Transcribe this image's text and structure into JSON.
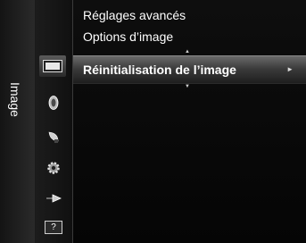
{
  "tab": {
    "label": "Image"
  },
  "sidebar": {
    "items": [
      {
        "icon": "picture-icon",
        "selected": true
      },
      {
        "icon": "sound-icon"
      },
      {
        "icon": "channel-icon"
      },
      {
        "icon": "setup-icon"
      },
      {
        "icon": "input-icon"
      },
      {
        "icon": "help-icon",
        "label": "?"
      }
    ]
  },
  "menu": {
    "items": [
      {
        "label": "Réglages avancés"
      },
      {
        "label": "Options d’image"
      },
      {
        "label": "Réinitialisation de l’image",
        "highlighted": true
      }
    ],
    "submenu_arrow": "►",
    "up_arrow": "▲",
    "down_arrow": "▼",
    "selected_arrow": "◄"
  },
  "colors": {
    "highlight": "#5a5a5a",
    "text": "#ffffff",
    "background": "#000000"
  }
}
